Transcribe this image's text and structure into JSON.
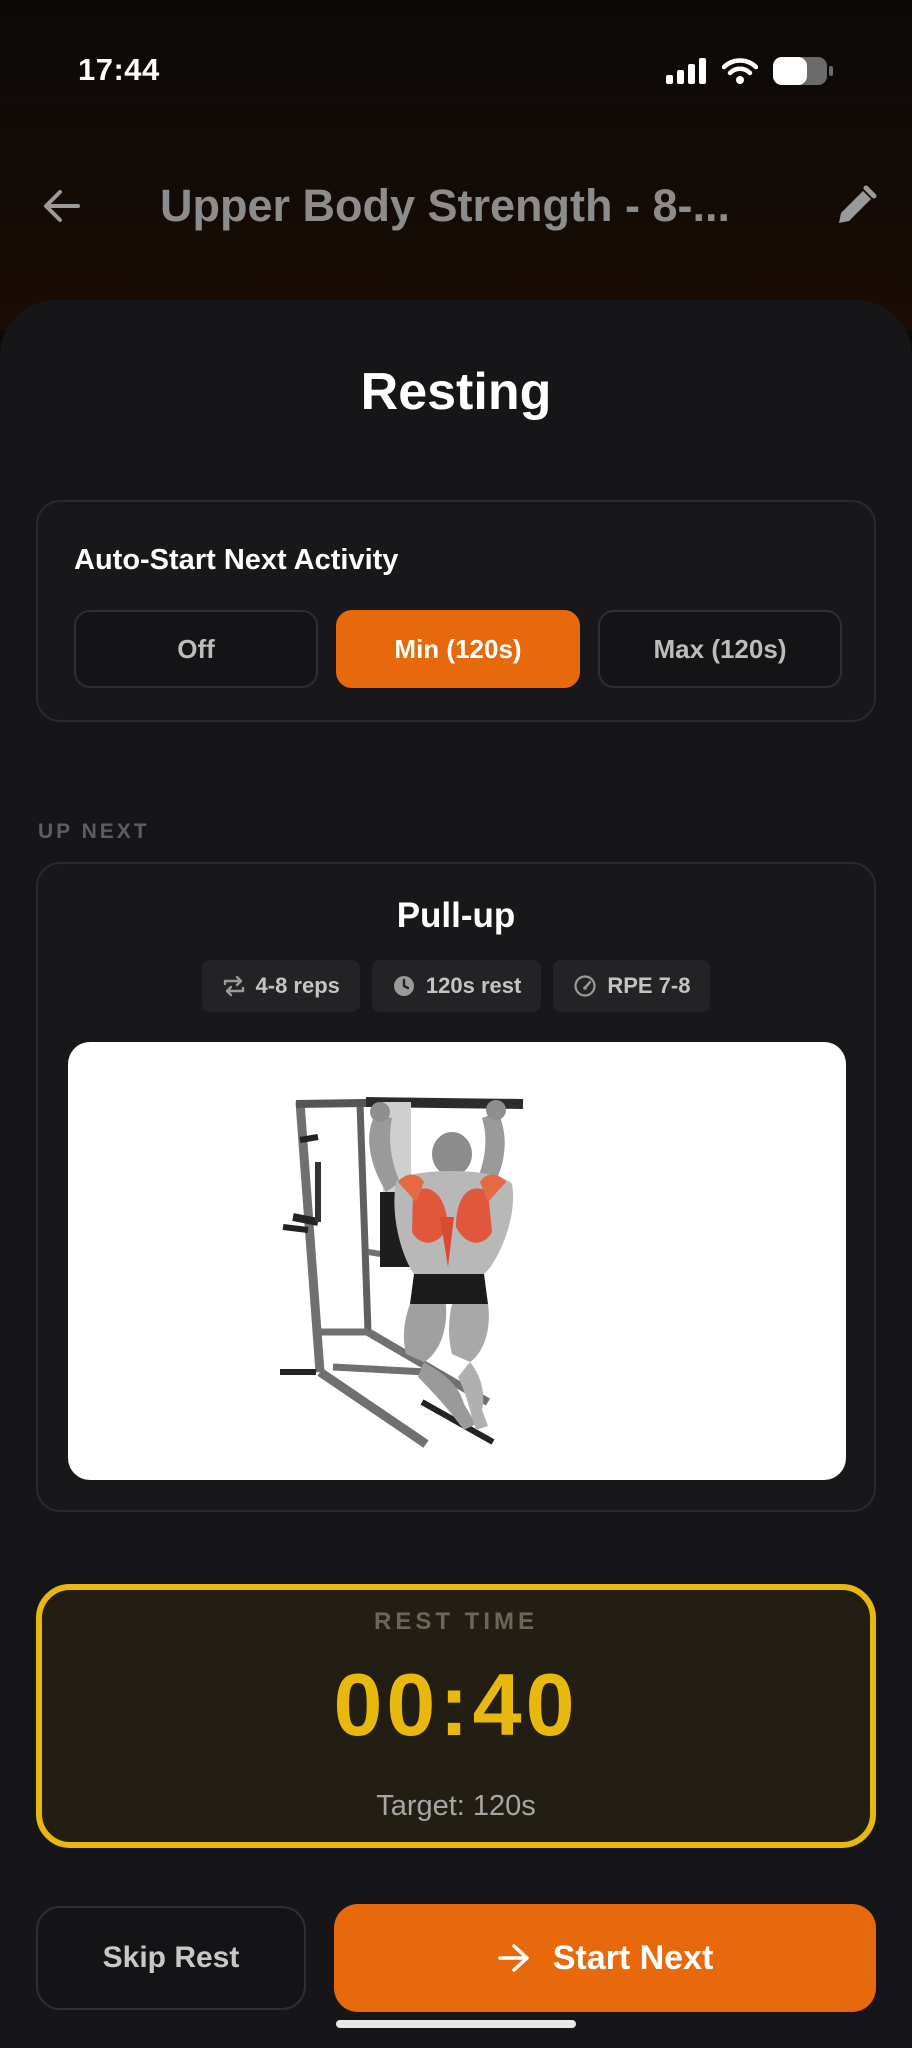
{
  "status_bar": {
    "time": "17:44",
    "icons": [
      "cellular-signal-icon",
      "wifi-icon",
      "battery-icon"
    ]
  },
  "header": {
    "title": "Upper Body Strength - 8-...",
    "back_icon": "arrow-left-icon",
    "edit_icon": "pencil-icon"
  },
  "sheet": {
    "title": "Resting"
  },
  "auto_start": {
    "label": "Auto-Start Next Activity",
    "options": [
      {
        "label": "Off",
        "selected": false
      },
      {
        "label": "Min (120s)",
        "selected": true
      },
      {
        "label": "Max (120s)",
        "selected": false
      }
    ]
  },
  "up_next": {
    "section_label": "UP NEXT",
    "exercise_name": "Pull-up",
    "chips": [
      {
        "icon": "repeat-icon",
        "label": "4-8 reps"
      },
      {
        "icon": "clock-icon",
        "label": "120s rest"
      },
      {
        "icon": "gauge-icon",
        "label": "RPE 7-8"
      }
    ]
  },
  "rest": {
    "label": "REST TIME",
    "time": "00:40",
    "target": "Target: 120s"
  },
  "actions": {
    "skip_label": "Skip Rest",
    "start_label": "Start Next"
  },
  "colors": {
    "accent": "#e8690c",
    "timer": "#e8b90c",
    "background": "#161618"
  }
}
